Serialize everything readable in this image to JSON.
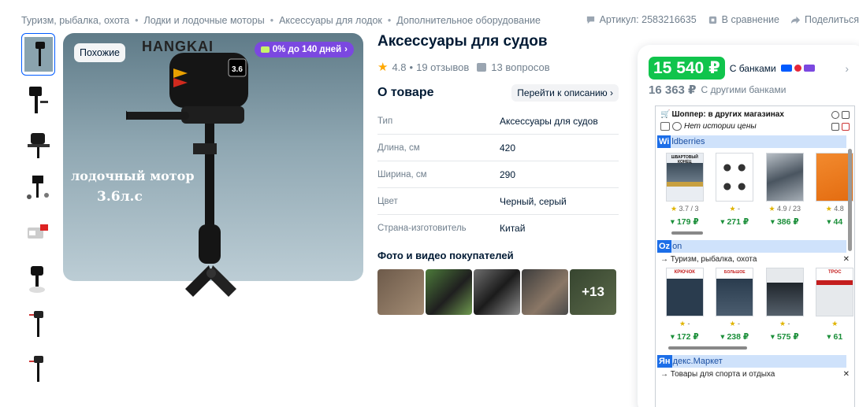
{
  "breadcrumbs": [
    "Туризм, рыбалка, охота",
    "Лодки и лодочные моторы",
    "Аксессуары для лодок",
    "Дополнительное оборудование"
  ],
  "topbar": {
    "article": "Артикул: 2583216635",
    "compare": "В сравнение",
    "share": "Поделиться"
  },
  "gallery": {
    "badge_similar": "Похожие",
    "badge_promo": "0% до 140 дней",
    "brand": "HANGKAI",
    "image_text_1": "лодочный мотор",
    "image_text_2": "3.6л.с",
    "motor_label": "3.6"
  },
  "product": {
    "title": "Аксессуары для судов",
    "rating": "4.8",
    "reviews": "19 отзывов",
    "questions": "13 вопросов",
    "about_title": "О товаре",
    "about_link": "Перейти к описанию",
    "specs": [
      {
        "k": "Тип",
        "v": "Аксессуары для судов"
      },
      {
        "k": "Длина, см",
        "v": "420"
      },
      {
        "k": "Ширина, см",
        "v": "290"
      },
      {
        "k": "Цвет",
        "v": "Черный, серый"
      },
      {
        "k": "Страна-изготовитель",
        "v": "Китай"
      }
    ],
    "photos_title": "Фото и видео покупателей",
    "photos_more": "+13"
  },
  "price": {
    "main": "15 540 ₽",
    "main_label": "С банками",
    "old": "16 363 ₽",
    "old_label": "С другими банками"
  },
  "shopper": {
    "title": "Шоппер: в других магазинах",
    "no_history": "Нет истории цены",
    "stores": [
      {
        "hl": "Wi",
        "rest": "ldberries",
        "category": "",
        "items": [
          {
            "rating": "3.7 / 3",
            "price": "179 ₽"
          },
          {
            "rating": "-",
            "price": "271 ₽"
          },
          {
            "rating": "4.9 / 23",
            "price": "386 ₽"
          },
          {
            "rating": "4.8",
            "price": "44"
          }
        ]
      },
      {
        "hl": "Oz",
        "rest": "on",
        "category": "→ Туризм, рыбалка, охота",
        "items": [
          {
            "rating": "-",
            "price": "172 ₽"
          },
          {
            "rating": "-",
            "price": "238 ₽"
          },
          {
            "rating": "-",
            "price": "575 ₽"
          },
          {
            "rating": "",
            "price": "61"
          }
        ]
      },
      {
        "hl": "Ян",
        "rest": "декс.Маркет",
        "category": "→ Товары для спорта и отдыха",
        "items": []
      }
    ],
    "card_labels": [
      "ШВАРТОВЫЙ КОНЕЦ",
      "",
      "",
      "",
      "КРЮЧОК",
      "БОЛЬШОЕ",
      "",
      "ТРОС"
    ]
  },
  "colors": {
    "accent": "#005bff",
    "price_green": "#10c44c",
    "promo_purple": "#7b48e0"
  }
}
